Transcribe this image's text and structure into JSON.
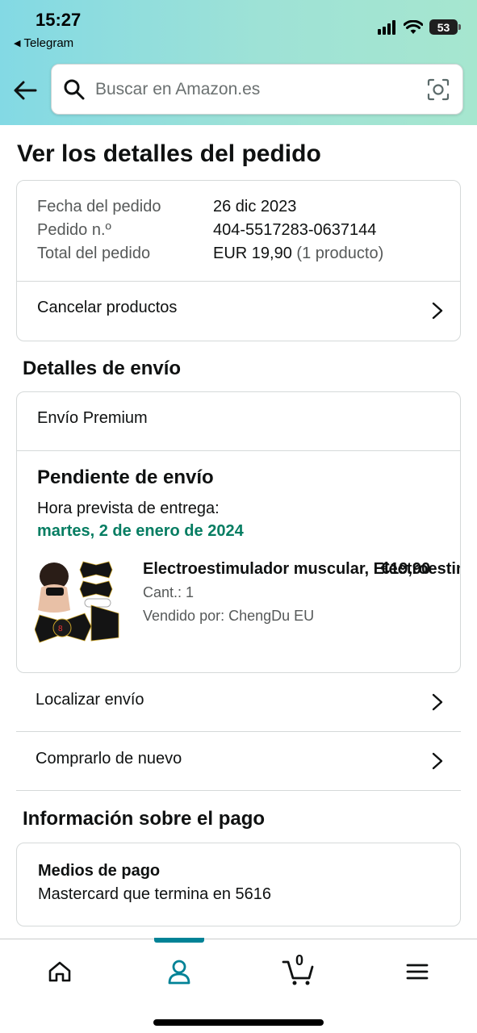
{
  "status_bar": {
    "time": "15:27",
    "back_app": "Telegram",
    "battery": "53"
  },
  "search": {
    "placeholder": "Buscar en Amazon.es"
  },
  "page_title": "Ver los detalles del pedido",
  "order_summary": {
    "rows": [
      {
        "label": "Fecha del pedido",
        "value": "26 dic 2023"
      },
      {
        "label": "Pedido n.º",
        "value": "404-5517283-0637144"
      },
      {
        "label": "Total del pedido",
        "value": "EUR 19,90",
        "note": "(1 producto)"
      }
    ],
    "cancel_label": "Cancelar productos"
  },
  "shipping": {
    "section_title": "Detalles de envío",
    "method": "Envío Premium",
    "status": "Pendiente de envío",
    "eta_label": "Hora prevista de entrega:",
    "eta_date": "martes, 2 de enero de 2024",
    "product": {
      "name": "Electroestimulador muscular, Electroestim",
      "price": "€19,90",
      "qty": "Cant.: 1",
      "seller": "Vendido por: ChengDu EU"
    }
  },
  "actions": {
    "track": "Localizar envío",
    "buy_again": "Comprarlo de nuevo"
  },
  "payment": {
    "section_title": "Información sobre el pago",
    "label": "Medios de pago",
    "value": "Mastercard  que termina en 5616"
  },
  "tabbar": {
    "cart_count": "0",
    "active_tab": "account"
  },
  "colors": {
    "accent": "#008296",
    "eta_green": "#067d62"
  },
  "icons": [
    "back-arrow-icon",
    "search-icon",
    "camera-icon",
    "chevron-right-icon",
    "home-icon",
    "account-icon",
    "cart-icon",
    "menu-icon"
  ]
}
